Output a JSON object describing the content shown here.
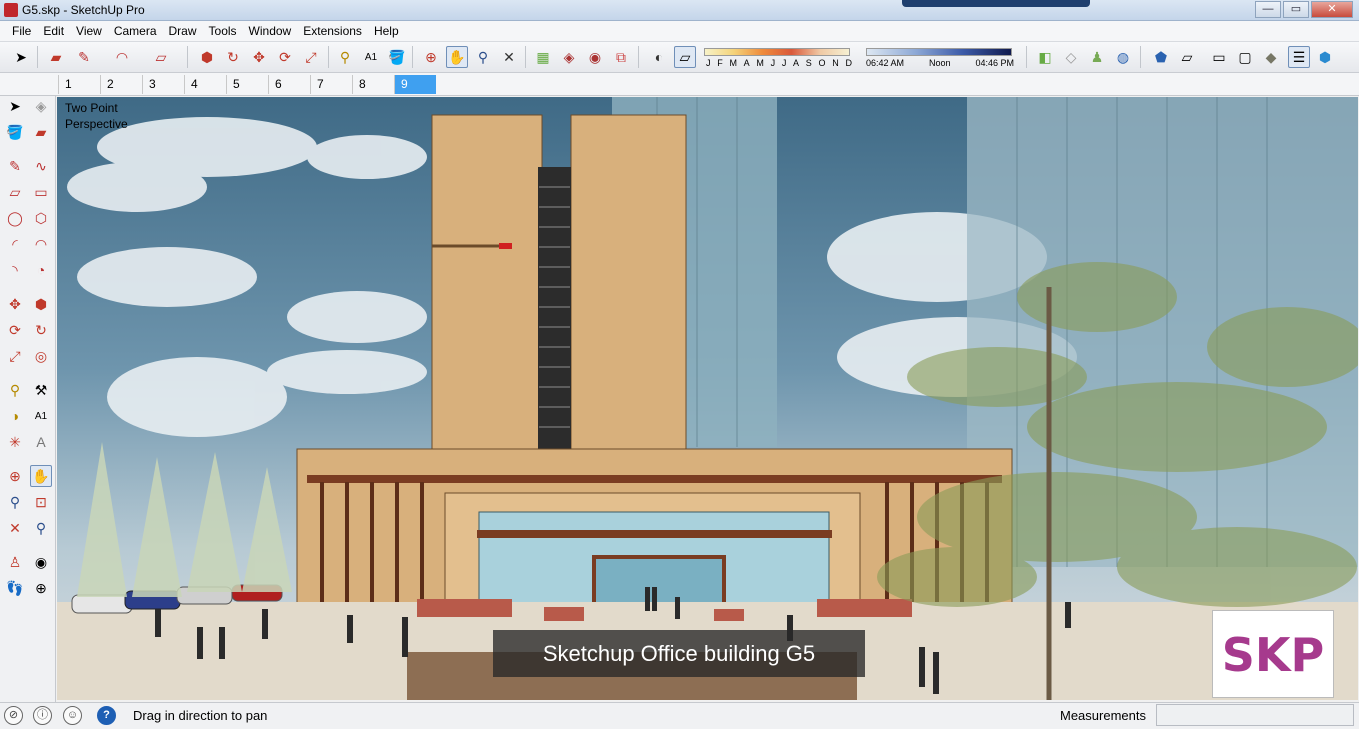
{
  "window": {
    "title": "G5.skp - SketchUp Pro",
    "minimize_label": "—",
    "maximize_label": "▭",
    "close_label": "✕"
  },
  "menu": [
    "File",
    "Edit",
    "View",
    "Camera",
    "Draw",
    "Tools",
    "Window",
    "Extensions",
    "Help"
  ],
  "toolbar": {
    "icons": [
      "select-icon",
      "eraser-icon",
      "pencil-icon",
      "arc-icon",
      "rectangle-icon",
      "push-pull-icon",
      "follow-me-icon",
      "move-icon",
      "rotate-icon",
      "scale-icon",
      "tape-measure-icon",
      "text-icon",
      "paint-bucket-icon",
      "orbit-icon",
      "pan-icon",
      "zoom-icon",
      "zoom-extents-icon",
      "warehouse-icon",
      "extension-warehouse-icon",
      "layout-icon",
      "send-to-layout-icon",
      "shadows-toggle-icon",
      "shadow-settings-icon",
      "section-plane-icon",
      "section-fill-icon",
      "walk-icon",
      "position-camera-icon",
      "iso-view-icon",
      "top-view-icon",
      "front-view-icon",
      "right-view-icon",
      "back-view-icon",
      "left-view-icon",
      "xray-icon",
      "hidden-line-icon"
    ],
    "active": "pan-icon"
  },
  "shadows": {
    "months": [
      "J",
      "F",
      "M",
      "A",
      "M",
      "J",
      "J",
      "A",
      "S",
      "O",
      "N",
      "D"
    ],
    "time_start": "06:42 AM",
    "time_mid": "Noon",
    "time_end": "04:46 PM",
    "month_gradient": [
      "#f7f2c8",
      "#f4d37a",
      "#ef8b3c",
      "#d9593b",
      "#f0c9a5",
      "#f6f0d2"
    ],
    "time_gradient": [
      "#dde7f2",
      "#8ea9d6",
      "#3c5aa8",
      "#101a4e"
    ]
  },
  "scenes": {
    "tabs": [
      "1",
      "2",
      "3",
      "4",
      "5",
      "6",
      "7",
      "8",
      "9"
    ],
    "active": "9"
  },
  "left_tools": [
    "select-icon",
    "component-icon",
    "paint-bucket-icon",
    "eraser-icon",
    "pencil-icon",
    "freehand-icon",
    "rectangle-icon",
    "rotated-rectangle-icon",
    "circle-icon",
    "polygon-icon",
    "arc-icon",
    "two-point-arc-icon",
    "three-point-arc-icon",
    "pie-icon",
    "move-icon",
    "push-pull-icon",
    "rotate-icon",
    "follow-me-icon",
    "scale-icon",
    "offset-icon",
    "tape-measure-icon",
    "dimension-icon",
    "protractor-icon",
    "text-icon",
    "axes-icon",
    "3d-text-icon",
    "orbit-icon",
    "pan-icon",
    "zoom-icon",
    "zoom-window-icon",
    "zoom-extents-icon",
    "previous-view-icon",
    "position-camera-icon",
    "look-around-icon",
    "walk-icon",
    "section-plane-icon"
  ],
  "viewport": {
    "camera_label": "Two Point Perspective",
    "caption": "Sketchup Office building G5",
    "badge": "SKP"
  },
  "status": {
    "message": "Drag in direction to pan",
    "measurements_label": "Measurements",
    "measurements_value": ""
  },
  "colors": {
    "sky_top": "#3f6a86",
    "building_facade": "#d8b07c",
    "accent_tab": "#3fa0f0",
    "badge_text": "#a63a8d"
  }
}
